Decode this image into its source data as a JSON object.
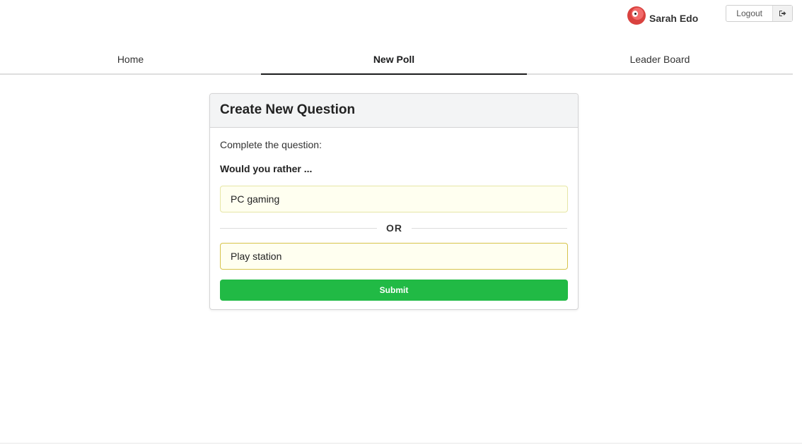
{
  "user": {
    "name": "Sarah Edo",
    "logout_label": "Logout",
    "logout_icon": "sign-out-icon"
  },
  "nav": {
    "tabs": [
      {
        "label": "Home",
        "active": false
      },
      {
        "label": "New Poll",
        "active": true
      },
      {
        "label": "Leader Board",
        "active": false
      }
    ]
  },
  "form": {
    "title": "Create New Question",
    "instructions": "Complete the question:",
    "prompt": "Would you rather ...",
    "option_one": "PC gaming",
    "divider": "OR",
    "option_two": "Play station",
    "submit_label": "Submit"
  },
  "colors": {
    "accent_green": "#21ba45",
    "input_bg": "#fffff0",
    "active_tab_underline": "#1b1c1d"
  }
}
